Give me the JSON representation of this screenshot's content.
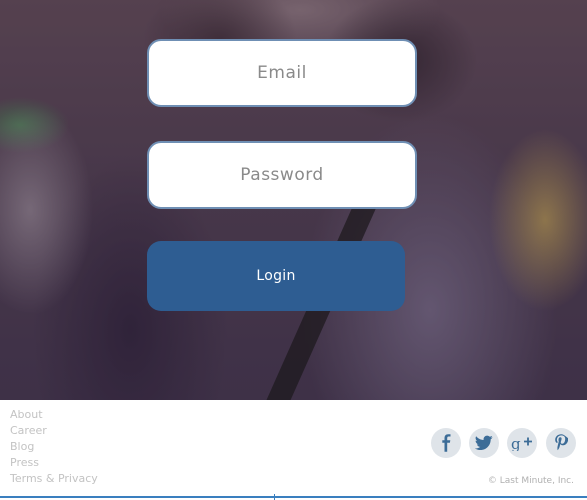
{
  "login_form": {
    "email_placeholder": "Email",
    "password_placeholder": "Password",
    "login_label": "Login"
  },
  "footer": {
    "links": [
      "About",
      "Career",
      "Blog",
      "Press",
      "Terms & Privacy"
    ],
    "social_icons": [
      "facebook-icon",
      "twitter-icon",
      "google-plus-icon",
      "pinterest-icon"
    ],
    "copyright": "© Last Minute, Inc."
  },
  "colors": {
    "button_blue": "#2e5d92",
    "social_icon": "#3c6c97",
    "link_gray": "#c3c3c3",
    "field_border": "#6f8fb4"
  }
}
